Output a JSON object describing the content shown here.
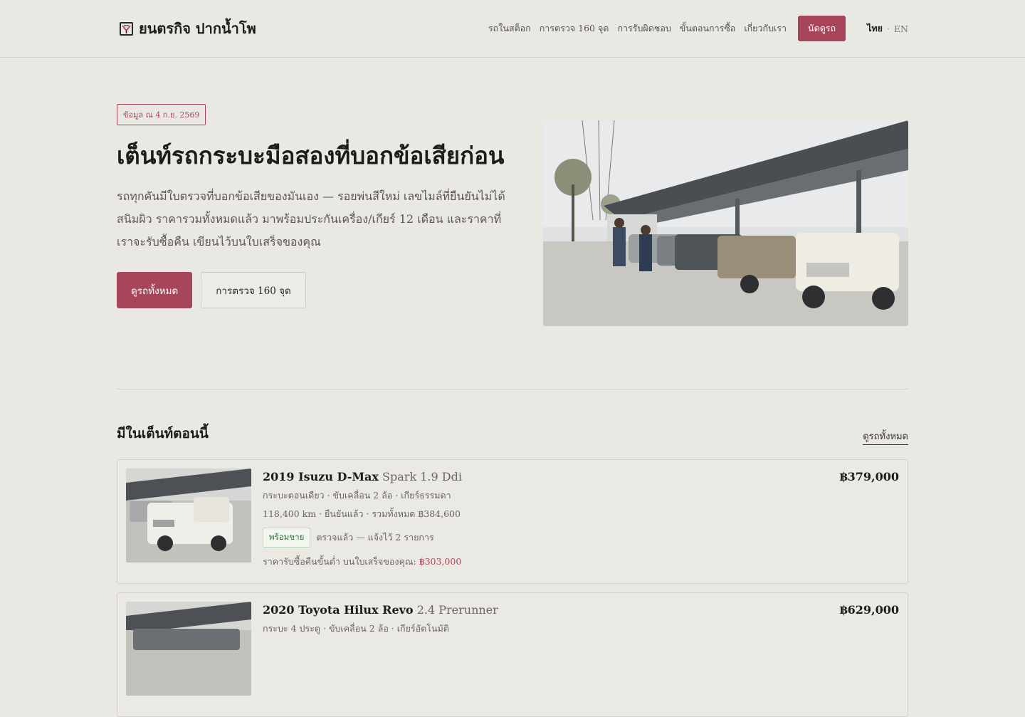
{
  "header": {
    "brand": "ยนตรกิจ ปากน้ำโพ",
    "nav": [
      "รถในสต็อก",
      "การตรวจ 160 จุด",
      "การรับผิดชอบ",
      "ขั้นตอนการซื้อ",
      "เกี่ยวกับเรา"
    ],
    "cta": "นัดดูรถ",
    "lang_active": "ไทย",
    "lang_sep": "·",
    "lang_other": "EN"
  },
  "hero": {
    "badge": "ข้อมูล ณ 4 ก.ย. 2569",
    "title": "เต็นท์รถกระบะมือสองที่บอกข้อเสียก่อน",
    "description": "รถทุกคันมีใบตรวจที่บอกข้อเสียของมันเอง — รอยพ่นสีใหม่ เลขไมล์ที่ยืนยันไม่ได้ สนิมผิว ราคารวมทั้งหมดแล้ว มาพร้อมประกันเครื่อง/เกียร์ 12 เดือน และราคาที่เราจะรับซื้อคืน เขียนไว้บนใบเสร็จของคุณ",
    "primary_button": "ดูรถทั้งหมด",
    "secondary_button": "การตรวจ 160 จุด"
  },
  "inventory": {
    "title": "มีในเต็นท์ตอนนี้",
    "see_all": "ดูรถทั้งหมด",
    "listings": [
      {
        "model": "2019 Isuzu D-Max",
        "trim": "Spark 1.9 Ddi",
        "price": "฿379,000",
        "spec": "กระบะตอนเดียว · ขับเคลื่อน 2 ล้อ · เกียร์ธรรมดา",
        "meta": "118,400 km · ยืนยันแล้ว · รวมทั้งหมด ฿384,600",
        "status": "พร้อมขาย",
        "status_note": "ตรวจแล้ว — แจ้งไว้ 2 รายการ",
        "buyback_label": "ราคารับซื้อคืนขั้นต่ำ บนใบเสร็จของคุณ:",
        "buyback_amount": "฿303,000"
      },
      {
        "model": "2020 Toyota Hilux Revo",
        "trim": "2.4 Prerunner",
        "price": "฿629,000",
        "spec": "กระบะ 4 ประตู · ขับเคลื่อน 2 ล้อ · เกียร์อัตโนมัติ"
      }
    ]
  },
  "colors": {
    "accent": "#a7465a",
    "background": "#eae8e2",
    "ready_green": "#2f6b3b"
  }
}
